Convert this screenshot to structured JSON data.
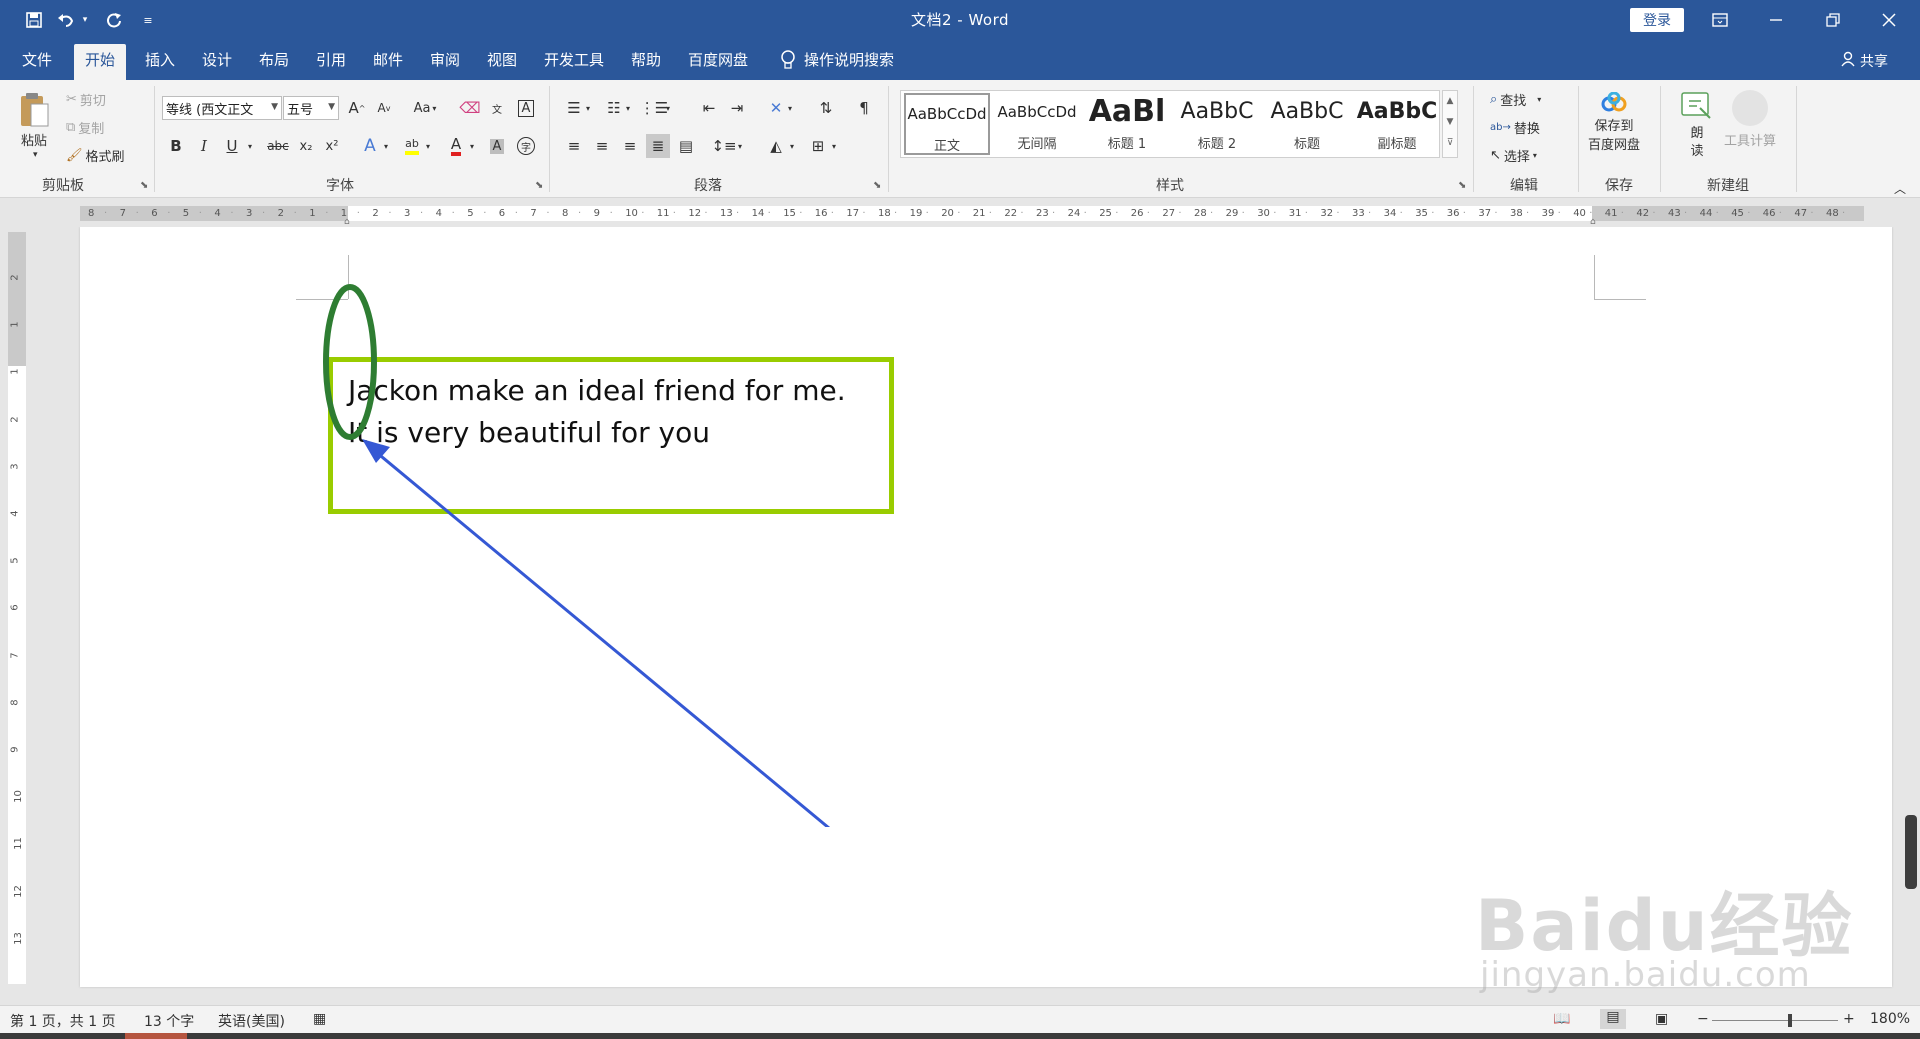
{
  "titlebar": {
    "title": "文档2  -  Word",
    "login": "登录",
    "quick_access": {
      "save_icon": "save-icon",
      "undo_icon": "undo-icon",
      "redo_icon": "redo-icon",
      "customize_icon": "customize-qat-icon"
    }
  },
  "menu": {
    "tabs": [
      "文件",
      "开始",
      "插入",
      "设计",
      "布局",
      "引用",
      "邮件",
      "审阅",
      "视图",
      "开发工具",
      "帮助",
      "百度网盘"
    ],
    "active_tab": "开始",
    "tell_me": "操作说明搜索",
    "share": "共享"
  },
  "ribbon": {
    "clipboard": {
      "paste": "粘贴",
      "cut": "剪切",
      "copy": "复制",
      "format_painter": "格式刷",
      "label": "剪贴板"
    },
    "font": {
      "font_name": "等线 (西文正文",
      "font_size": "五号",
      "grow": "A",
      "shrink": "A",
      "case": "Aa",
      "bold": "B",
      "italic": "I",
      "underline": "U",
      "strikethrough": "abc",
      "subscript": "x₂",
      "superscript": "x²",
      "text_effects": "A",
      "highlight": "ab",
      "font_color": "A",
      "char_shading": "A",
      "enclose": "字",
      "label": "字体"
    },
    "paragraph": {
      "label": "段落"
    },
    "styles": {
      "items": [
        {
          "preview": "AaBbCcDd",
          "name": "正文"
        },
        {
          "preview": "AaBbCcDd",
          "name": "无间隔"
        },
        {
          "preview": "AaBl",
          "name": "标题 1"
        },
        {
          "preview": "AaBbC",
          "name": "标题 2"
        },
        {
          "preview": "AaBbC",
          "name": "标题"
        },
        {
          "preview": "AaBbC",
          "name": "副标题"
        }
      ],
      "label": "样式"
    },
    "editing": {
      "find": "查找",
      "replace": "替换",
      "select": "选择",
      "label": "编辑"
    },
    "save": {
      "save_to_baidu_line1": "保存到",
      "save_to_baidu_line2": "百度网盘",
      "label": "保存"
    },
    "new_group": {
      "read_aloud_line1": "朗",
      "read_aloud_line2": "读",
      "tool_calc": "工具计算",
      "label": "新建组"
    }
  },
  "rulers": {
    "tab_selector": "L",
    "horizontal_labels": [
      "8",
      "7",
      "6",
      "5",
      "4",
      "3",
      "2",
      "1",
      "1",
      "2",
      "3",
      "4",
      "5",
      "6",
      "7",
      "8",
      "9",
      "10",
      "11",
      "12",
      "13",
      "14",
      "15",
      "16",
      "17",
      "18",
      "19",
      "20",
      "21",
      "22",
      "23",
      "24",
      "25",
      "26",
      "27",
      "28",
      "29",
      "30",
      "31",
      "32",
      "33",
      "34",
      "35",
      "36",
      "37",
      "38",
      "39",
      "40",
      "41",
      "42",
      "43",
      "44",
      "45",
      "46",
      "47",
      "48"
    ],
    "vertical_labels": [
      "2",
      "1",
      "1",
      "2",
      "3",
      "4",
      "5",
      "6",
      "7",
      "8",
      "9",
      "10",
      "11",
      "12",
      "13"
    ]
  },
  "document": {
    "lines": [
      "Jackon make an ideal friend for me.",
      "It is very beautiful for you"
    ],
    "box_color": "#99cc00",
    "ellipse_color": "#2e7d32",
    "arrow_color": "#3558d4"
  },
  "statusbar": {
    "page": "第 1 页，共 1 页",
    "words": "13 个字",
    "language": "英语(美国)",
    "zoom": "180%",
    "zoom_level": 0.6
  },
  "watermark": {
    "text": "Baidu经验",
    "url": "jingyan.baidu.com"
  }
}
